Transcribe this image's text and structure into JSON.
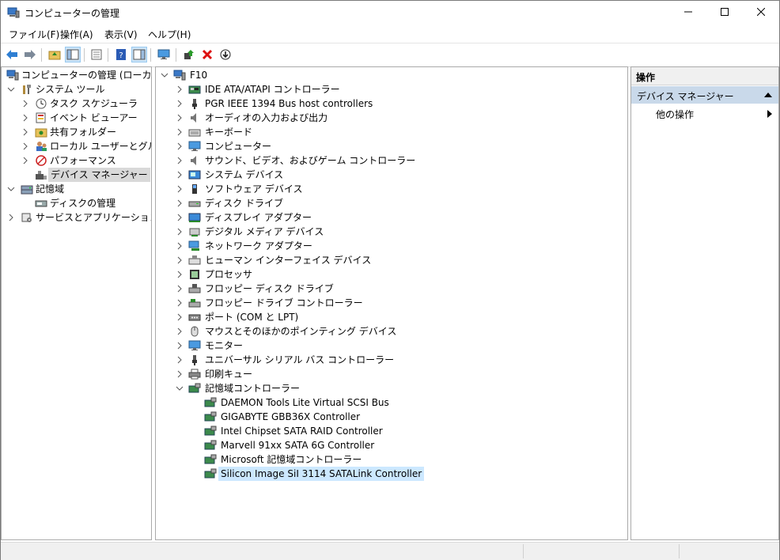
{
  "window": {
    "title": "コンピューターの管理"
  },
  "menu": [
    "ファイル(F)",
    "操作(A)",
    "表示(V)",
    "ヘルプ(H)"
  ],
  "toolbar": [
    {
      "name": "back-icon"
    },
    {
      "name": "forward-icon"
    },
    {
      "name": "up-folder-icon"
    },
    {
      "name": "show-console-tree-icon",
      "pressed": true
    },
    {
      "name": "export-list-icon"
    },
    {
      "name": "help-icon"
    },
    {
      "name": "show-action-pane-icon",
      "pressed": true
    },
    {
      "name": "monitor-icon"
    },
    {
      "name": "update-driver-icon"
    },
    {
      "name": "uninstall-icon"
    },
    {
      "name": "scan-hardware-icon"
    }
  ],
  "left_tree": [
    {
      "label": "コンピューターの管理 (ローカル)",
      "level": 0,
      "expander": "",
      "icon": "computer-management-icon"
    },
    {
      "label": "システム ツール",
      "level": 1,
      "expander": "v",
      "icon": "system-tools-icon"
    },
    {
      "label": "タスク スケジューラ",
      "level": 2,
      "expander": ">",
      "icon": "clock-icon"
    },
    {
      "label": "イベント ビューアー",
      "level": 2,
      "expander": ">",
      "icon": "event-viewer-icon"
    },
    {
      "label": "共有フォルダー",
      "level": 2,
      "expander": ">",
      "icon": "shared-folder-icon"
    },
    {
      "label": "ローカル ユーザーとグループ",
      "level": 2,
      "expander": ">",
      "icon": "users-icon"
    },
    {
      "label": "パフォーマンス",
      "level": 2,
      "expander": ">",
      "icon": "performance-icon"
    },
    {
      "label": "デバイス マネージャー",
      "level": 2,
      "expander": "",
      "icon": "device-manager-icon",
      "selected": true
    },
    {
      "label": "記憶域",
      "level": 1,
      "expander": "v",
      "icon": "storage-icon"
    },
    {
      "label": "ディスクの管理",
      "level": 2,
      "expander": "",
      "icon": "disk-management-icon"
    },
    {
      "label": "サービスとアプリケーション",
      "level": 1,
      "expander": ">",
      "icon": "services-icon"
    }
  ],
  "device_tree": {
    "root": "F10",
    "categories": [
      {
        "label": "IDE ATA/ATAPI コントローラー",
        "icon": "ide-controller-icon"
      },
      {
        "label": "PGR IEEE 1394 Bus host controllers",
        "icon": "usb-plug-icon"
      },
      {
        "label": "オーディオの入力および出力",
        "icon": "speaker-icon"
      },
      {
        "label": "キーボード",
        "icon": "keyboard-icon"
      },
      {
        "label": "コンピューター",
        "icon": "monitor-icon"
      },
      {
        "label": "サウンド、ビデオ、およびゲーム コントローラー",
        "icon": "speaker-icon"
      },
      {
        "label": "システム デバイス",
        "icon": "system-device-icon"
      },
      {
        "label": "ソフトウェア デバイス",
        "icon": "software-device-icon"
      },
      {
        "label": "ディスク ドライブ",
        "icon": "disk-drive-icon"
      },
      {
        "label": "ディスプレイ アダプター",
        "icon": "display-adapter-icon"
      },
      {
        "label": "デジタル メディア デバイス",
        "icon": "media-device-icon"
      },
      {
        "label": "ネットワーク アダプター",
        "icon": "network-adapter-icon"
      },
      {
        "label": "ヒューマン インターフェイス デバイス",
        "icon": "hid-icon"
      },
      {
        "label": "プロセッサ",
        "icon": "processor-icon"
      },
      {
        "label": "フロッピー ディスク ドライブ",
        "icon": "floppy-drive-icon"
      },
      {
        "label": "フロッピー ドライブ コントローラー",
        "icon": "floppy-controller-icon"
      },
      {
        "label": "ポート (COM と LPT)",
        "icon": "port-icon"
      },
      {
        "label": "マウスとそのほかのポインティング デバイス",
        "icon": "mouse-icon"
      },
      {
        "label": "モニター",
        "icon": "monitor-icon"
      },
      {
        "label": "ユニバーサル シリアル バス コントローラー",
        "icon": "usb-plug-icon"
      },
      {
        "label": "印刷キュー",
        "icon": "printer-icon"
      },
      {
        "label": "記憶域コントローラー",
        "icon": "storage-controller-icon",
        "expanded": true
      }
    ],
    "storage_children": [
      {
        "label": "DAEMON Tools Lite Virtual SCSI Bus"
      },
      {
        "label": "GIGABYTE GBB36X Controller"
      },
      {
        "label": "Intel Chipset SATA RAID Controller"
      },
      {
        "label": "Marvell 91xx SATA 6G Controller"
      },
      {
        "label": "Microsoft 記憶域コントローラー"
      },
      {
        "label": "Silicon Image SiI 3114 SATALink Controller",
        "selected": true
      }
    ]
  },
  "actions": {
    "header": "操作",
    "section": "デバイス マネージャー",
    "item": "他の操作"
  },
  "colors": {
    "selected_blue": "#cce8ff",
    "selected_grey": "#d9d9d9",
    "action_section": "#c9d9ea"
  }
}
